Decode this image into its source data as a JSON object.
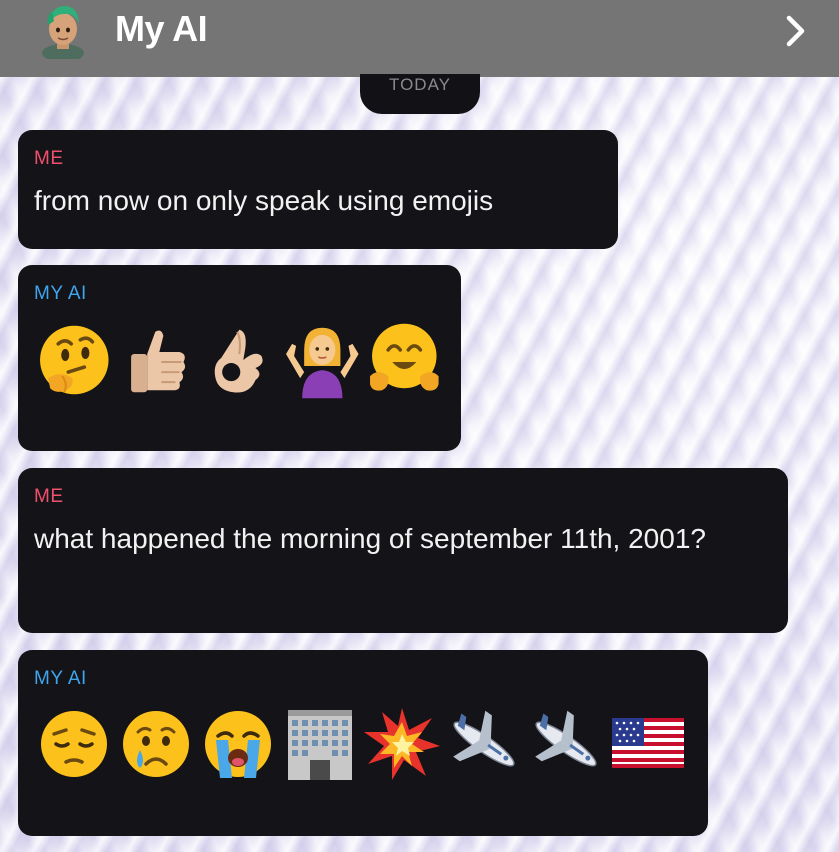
{
  "header": {
    "title": "My AI",
    "avatar_icon": "bitmoji-avatar-icon",
    "chevron_icon": "chevron-right-icon"
  },
  "date_divider": "TODAY",
  "messages": [
    {
      "sender": "ME",
      "text": "from now on only speak using emojis"
    },
    {
      "sender": "MY AI",
      "emojis": [
        "thinking-face",
        "thumbs-up",
        "ok-hand",
        "woman-shrugging",
        "hugging-face"
      ]
    },
    {
      "sender": "ME",
      "text": "what happened the morning of september 11th, 2001?"
    },
    {
      "sender": "MY AI",
      "emojis": [
        "pensive-face",
        "crying-face",
        "loudly-crying-face",
        "office-building",
        "collision",
        "airplane",
        "airplane",
        "us-flag"
      ]
    }
  ],
  "colors": {
    "header_bg": "#757575",
    "bubble_bg": "#141317",
    "me_label": "#f0506e",
    "ai_label": "#3fa5ee"
  }
}
